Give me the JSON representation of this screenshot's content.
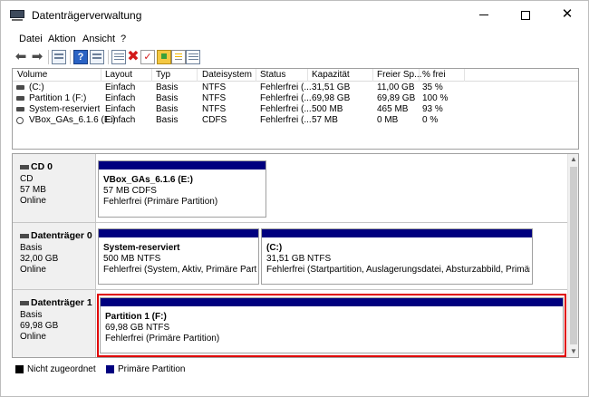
{
  "window": {
    "title": "Datenträgerverwaltung",
    "controls": {
      "minimize": "—",
      "maximize": "☐",
      "close": "✕"
    }
  },
  "menu": [
    "Datei",
    "Aktion",
    "Ansicht",
    "?"
  ],
  "toolbar": {
    "icons": [
      "back-arrow-icon",
      "forward-arrow-icon",
      "list-view-icon",
      "help-icon",
      "properties-icon",
      "connect-icon",
      "delete-icon",
      "check-icon",
      "folder-up-icon",
      "document-icon",
      "list-icon"
    ]
  },
  "volume_list": {
    "columns": [
      "Volume",
      "Layout",
      "Typ",
      "Dateisystem",
      "Status",
      "Kapazität",
      "Freier Sp...",
      "% frei"
    ],
    "rows": [
      {
        "volume": "(C:)",
        "layout": "Einfach",
        "typ": "Basis",
        "dateisystem": "NTFS",
        "status": "Fehlerfrei (...",
        "kapazitaet": "31,51 GB",
        "frei": "11,00 GB",
        "prozent": "35 %",
        "icon": "disk-icon"
      },
      {
        "volume": "Partition 1 (F:)",
        "layout": "Einfach",
        "typ": "Basis",
        "dateisystem": "NTFS",
        "status": "Fehlerfrei (...",
        "kapazitaet": "69,98 GB",
        "frei": "69,89 GB",
        "prozent": "100 %",
        "icon": "disk-icon"
      },
      {
        "volume": "System-reserviert",
        "layout": "Einfach",
        "typ": "Basis",
        "dateisystem": "NTFS",
        "status": "Fehlerfrei (...",
        "kapazitaet": "500 MB",
        "frei": "465 MB",
        "prozent": "93 %",
        "icon": "disk-icon"
      },
      {
        "volume": "VBox_GAs_6.1.6 (E:)",
        "layout": "Einfach",
        "typ": "Basis",
        "dateisystem": "CDFS",
        "status": "Fehlerfrei (...",
        "kapazitaet": "57 MB",
        "frei": "0 MB",
        "prozent": "0 %",
        "icon": "cd-icon"
      }
    ]
  },
  "disks": [
    {
      "name": "CD 0",
      "lines": [
        "CD",
        "57 MB",
        "Online"
      ],
      "partitions": [
        {
          "name": "VBox_GAs_6.1.6  (E:)",
          "size": "57 MB CDFS",
          "status": "Fehlerfrei (Primäre Partition)"
        }
      ]
    },
    {
      "name": "Datenträger 0",
      "lines": [
        "Basis",
        "32,00 GB",
        "Online"
      ],
      "partitions": [
        {
          "name": "System-reserviert",
          "size": "500 MB NTFS",
          "status": "Fehlerfrei (System, Aktiv, Primäre Partition)"
        },
        {
          "name": "(C:)",
          "size": "31,51 GB NTFS",
          "status": "Fehlerfrei (Startpartition, Auslagerungsdatei, Absturzabbild, Primäre Partit"
        }
      ]
    },
    {
      "name": "Datenträger 1",
      "lines": [
        "Basis",
        "69,98 GB",
        "Online"
      ],
      "partitions": [
        {
          "name": "Partition 1  (F:)",
          "size": "69,98 GB NTFS",
          "status": "Fehlerfrei (Primäre Partition)"
        }
      ]
    }
  ],
  "legend": [
    {
      "label": "Nicht zugeordnet",
      "color": "#000000"
    },
    {
      "label": "Primäre Partition",
      "color": "#00007f"
    }
  ],
  "colors": {
    "partition_bar": "#00007f",
    "highlight": "#e00000"
  }
}
